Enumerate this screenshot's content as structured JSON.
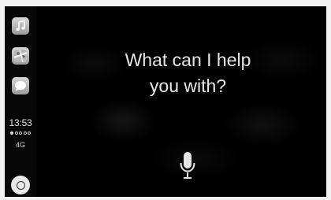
{
  "sidebar": {
    "apps": [
      {
        "name": "music",
        "icon": "music-note-icon"
      },
      {
        "name": "maps",
        "icon": "map-icon"
      },
      {
        "name": "messages",
        "icon": "speech-bubble-icon"
      }
    ],
    "status": {
      "time": "13:53",
      "signal_bars": 5,
      "signal_filled": 1,
      "network": "4G"
    },
    "home_icon": "home-button-icon"
  },
  "siri": {
    "prompt_line1": "What can I help",
    "prompt_line2": "you with?",
    "mic_icon": "microphone-icon"
  },
  "colors": {
    "background": "#000000",
    "text": "#e8e8e8",
    "icon_gradient_top": "#d9d9d9",
    "icon_gradient_bottom": "#9a9a9a"
  }
}
